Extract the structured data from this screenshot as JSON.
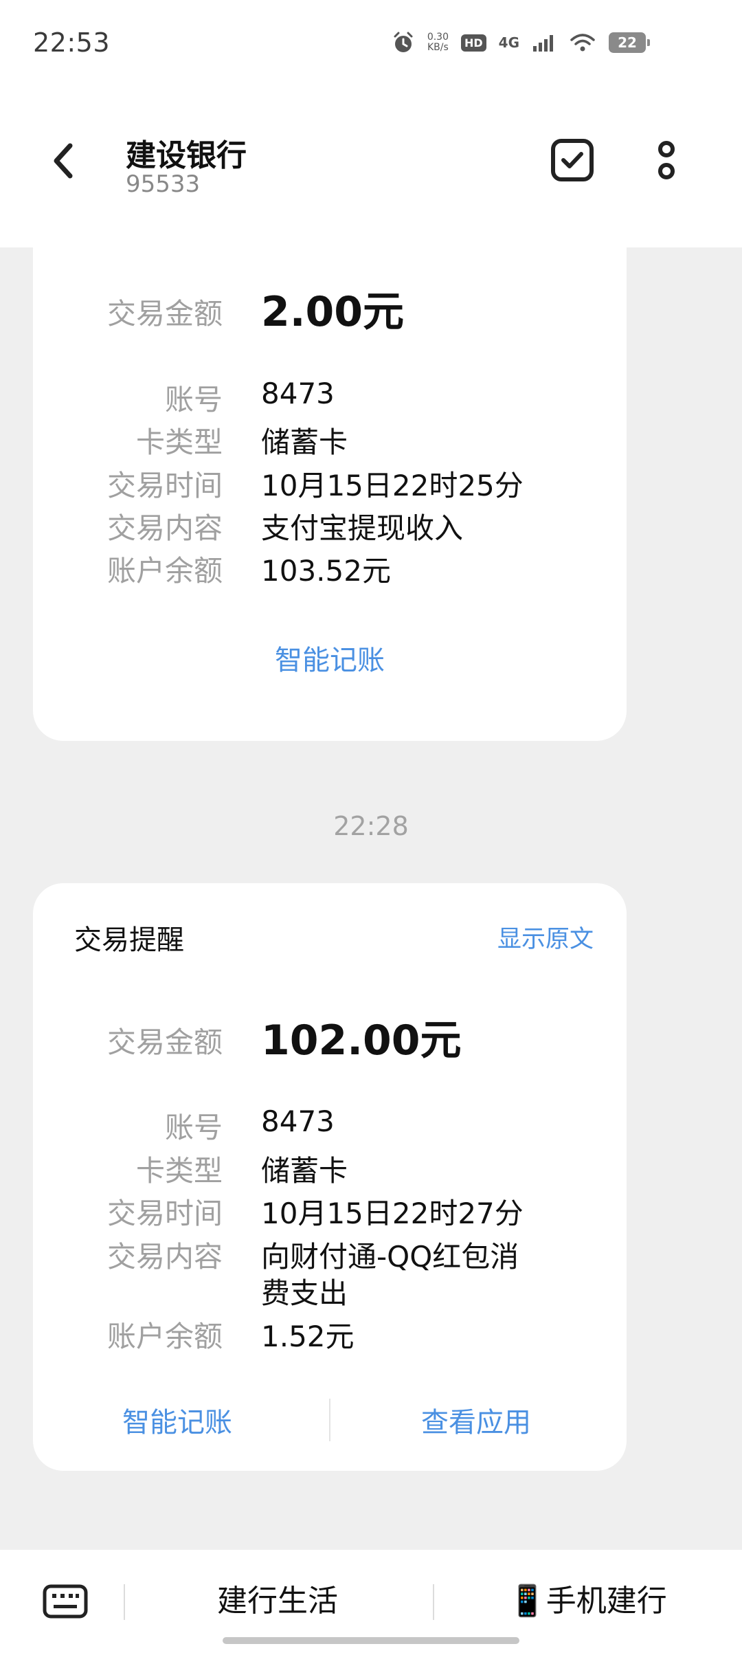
{
  "status": {
    "time": "22:53",
    "speed_value": "0.30",
    "speed_unit": "KB/s",
    "hd": "HD",
    "network": "4G",
    "battery": "22"
  },
  "header": {
    "title": "建设银行",
    "number": "95533"
  },
  "messages": [
    {
      "amount_label": "交易金额",
      "amount": "2.00元",
      "fields": [
        {
          "label": "账号",
          "value": "8473"
        },
        {
          "label": "卡类型",
          "value": "储蓄卡"
        },
        {
          "label": "交易时间",
          "value": "10月15日22时25分"
        },
        {
          "label": "交易内容",
          "value": "支付宝提现收入"
        },
        {
          "label": "账户余额",
          "value": "103.52元"
        }
      ],
      "action": "智能记账"
    },
    {
      "time": "22:28",
      "title": "交易提醒",
      "show_original": "显示原文",
      "amount_label": "交易金额",
      "amount": "102.00元",
      "fields": [
        {
          "label": "账号",
          "value": "8473"
        },
        {
          "label": "卡类型",
          "value": "储蓄卡"
        },
        {
          "label": "交易时间",
          "value": "10月15日22时27分"
        },
        {
          "label": "交易内容",
          "value_line1": "向财付通-QQ红包消",
          "value_line2": "费支出"
        },
        {
          "label": "账户余额",
          "value": "1.52元"
        }
      ],
      "actions": [
        "智能记账",
        "查看应用"
      ]
    }
  ],
  "bottom": {
    "life": "建行生活",
    "mobile_icon": "📱",
    "mobile": "手机建行"
  },
  "colors": {
    "link": "#4a90e2",
    "label": "#a0a0a0",
    "background": "#efefef"
  }
}
